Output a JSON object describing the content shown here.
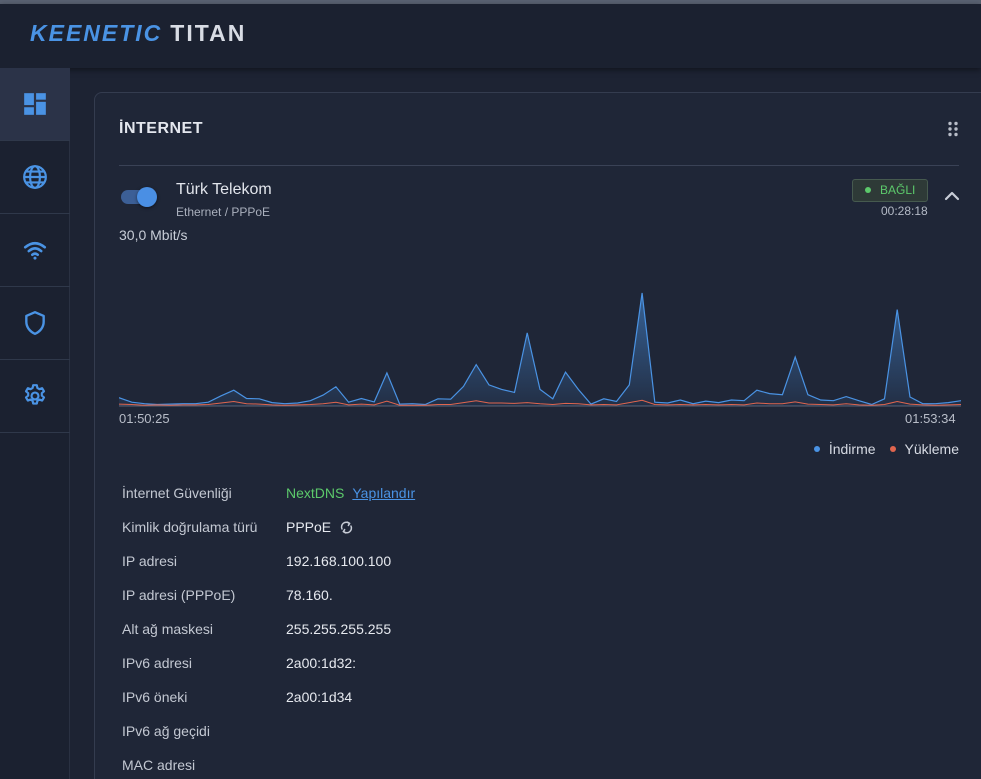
{
  "header": {
    "brand": "KEENETIC",
    "model": "TITAN"
  },
  "sidebar": {
    "items": [
      {
        "name": "dashboard-icon",
        "active": true
      },
      {
        "name": "globe-icon",
        "active": false
      },
      {
        "name": "wifi-icon",
        "active": false
      },
      {
        "name": "shield-icon",
        "active": false
      },
      {
        "name": "gear-icon",
        "active": false
      }
    ]
  },
  "panel": {
    "title": "İNTERNET",
    "menu_icon": "drag-dots-icon"
  },
  "connection": {
    "name": "Türk Telekom",
    "type": "Ethernet / PPPoE",
    "enabled": true,
    "status": "BAĞLI",
    "uptime": "00:28:18",
    "rate": "30,0 Mbit/s"
  },
  "colors": {
    "accent": "#4a93e4",
    "download": "#4a93e4",
    "upload": "#e0654e",
    "connected": "#5cc96b"
  },
  "chart_data": {
    "type": "area",
    "x_start": "01:50:25",
    "x_end": "01:53:34",
    "ylim": [
      0,
      30.0
    ],
    "y_unit": "Mbit/s",
    "series": [
      {
        "name": "İndirme",
        "values": [
          2.2,
          1.0,
          0.6,
          0.4,
          0.5,
          0.6,
          0.6,
          1.0,
          2.7,
          4.2,
          2.0,
          1.9,
          0.9,
          0.6,
          0.8,
          1.4,
          2.9,
          5.1,
          1.0,
          2.0,
          1.1,
          8.8,
          0.5,
          0.6,
          0.4,
          1.9,
          1.8,
          5.2,
          11.0,
          5.6,
          4.4,
          3.6,
          19.4,
          4.4,
          1.9,
          9.0,
          4.4,
          0.5,
          1.9,
          1.2,
          5.6,
          30.0,
          1.0,
          0.8,
          1.6,
          0.6,
          1.3,
          0.9,
          1.6,
          1.4,
          4.2,
          3.3,
          3.0,
          13.0,
          3.0,
          1.6,
          1.4,
          2.5,
          1.4,
          0.4,
          1.9,
          25.6,
          2.4,
          0.6,
          0.6,
          0.9,
          1.4
        ]
      },
      {
        "name": "Yükleme",
        "values": [
          0.5,
          0.4,
          0.2,
          0.3,
          0.2,
          0.3,
          0.3,
          0.4,
          0.8,
          1.2,
          0.6,
          0.5,
          0.3,
          0.2,
          0.3,
          0.4,
          0.6,
          1.0,
          0.3,
          0.5,
          0.3,
          1.3,
          0.2,
          0.2,
          0.2,
          0.4,
          0.4,
          0.9,
          1.4,
          0.8,
          0.8,
          0.7,
          0.9,
          0.6,
          0.4,
          0.7,
          0.6,
          0.3,
          0.4,
          0.3,
          0.9,
          1.5,
          0.4,
          0.3,
          0.4,
          0.3,
          0.4,
          0.3,
          0.4,
          0.3,
          0.8,
          0.6,
          0.6,
          1.1,
          0.5,
          0.4,
          0.3,
          0.6,
          0.3,
          0.2,
          0.4,
          1.2,
          0.5,
          0.3,
          0.2,
          0.3,
          0.4
        ]
      }
    ]
  },
  "legend": {
    "download": "İndirme",
    "upload": "Yükleme"
  },
  "info": [
    {
      "label": "İnternet Güvenliği",
      "value": "NextDNS",
      "link": "Yapılandır"
    },
    {
      "label": "Kimlik doğrulama türü",
      "value": "PPPoE",
      "icon": "refresh-icon"
    },
    {
      "label": "IP adresi",
      "value": "192.168.100.100"
    },
    {
      "label": "IP adresi (PPPoE)",
      "value": "78.160."
    },
    {
      "label": "Alt ağ maskesi",
      "value": "255.255.255.255"
    },
    {
      "label": "IPv6 adresi",
      "value": "2a00:1d32:"
    },
    {
      "label": "IPv6 öneki",
      "value": "2a00:1d34"
    },
    {
      "label": "IPv6 ağ geçidi",
      "value": ""
    },
    {
      "label": "MAC adresi",
      "value": ""
    }
  ]
}
